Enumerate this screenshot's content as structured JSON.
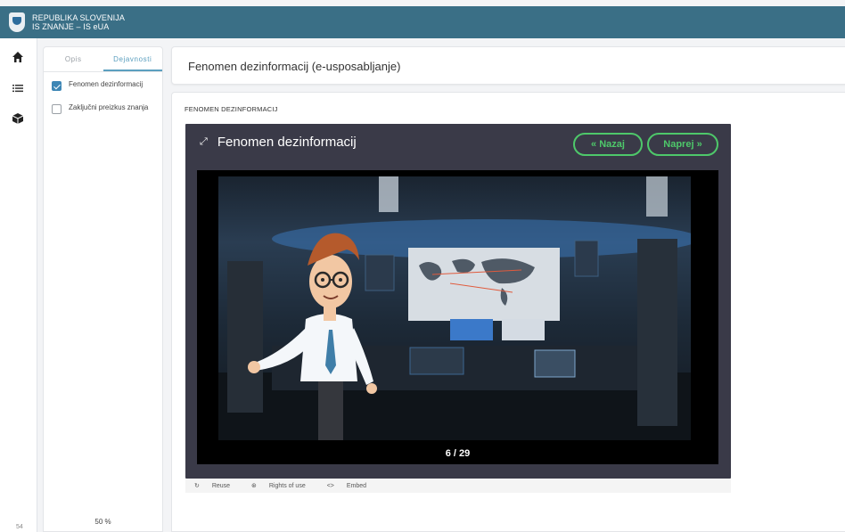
{
  "header": {
    "line1": "REPUBLIKA SLOVENIJA",
    "line2": "IS ZNANJE – IS eUA"
  },
  "rail": {
    "footer_num": "54"
  },
  "panel": {
    "tabs": [
      {
        "label": "Opis"
      },
      {
        "label": "Dejavnosti"
      }
    ],
    "activities": [
      {
        "label": "Fenomen dezinformacij",
        "checked": true
      },
      {
        "label": "Zaključni preizkus znanja",
        "checked": false
      }
    ],
    "progress": "50 %"
  },
  "page": {
    "title": "Fenomen dezinformacij (e-usposabljanje)"
  },
  "content": {
    "section_title": "FENOMEN DEZINFORMACIJ",
    "player": {
      "title": "Fenomen dezinformacij",
      "prev_label": "« Nazaj",
      "next_label": "Naprej »",
      "slide_counter": "6 / 29"
    },
    "footer_links": [
      "Reuse",
      "Rights of use",
      "Embed"
    ]
  },
  "colors": {
    "header": "#3a6f86",
    "accent": "#4ec86a",
    "tab_active": "#5b9fbf"
  }
}
